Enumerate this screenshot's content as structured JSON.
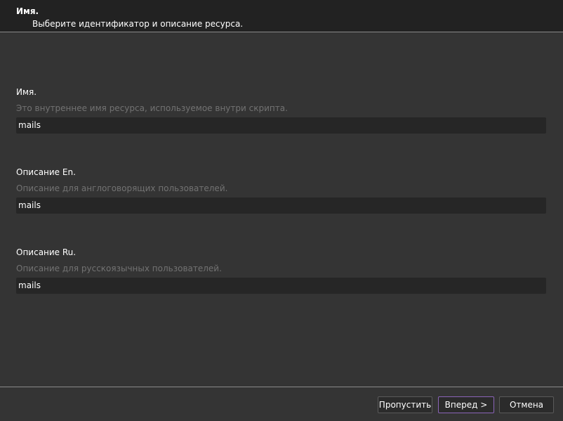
{
  "header": {
    "title": "Имя.",
    "subtitle": "Выберите идентификатор и описание ресурса."
  },
  "fields": [
    {
      "label": "Имя.",
      "description": "Это внутреннее имя ресурса, используемое внутри скрипта.",
      "value": "mails"
    },
    {
      "label": "Описание En.",
      "description": "Описание для англоговорящих пользователей.",
      "value": "mails"
    },
    {
      "label": "Описание Ru.",
      "description": "Описание для русскоязычных пользователей.",
      "value": "mails"
    }
  ],
  "buttons": {
    "skip": "Пропустить",
    "next": "Вперед >",
    "cancel": "Отмена"
  },
  "colors": {
    "background": "#343434",
    "header_background": "#222222",
    "input_background": "#262626",
    "description_text": "#727272",
    "primary_button_border": "#8b64b8"
  }
}
